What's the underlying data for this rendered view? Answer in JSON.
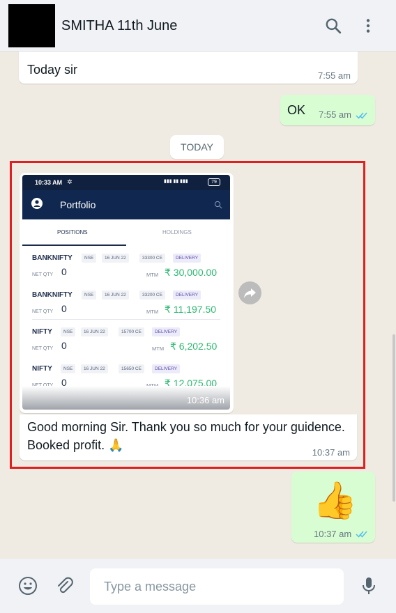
{
  "header": {
    "contact_name": "SMITHA 11th June",
    "icons": [
      "search-icon",
      "menu-icon"
    ]
  },
  "messages": {
    "m1": {
      "text": "Today sir",
      "time": "7:55 am",
      "direction": "incoming"
    },
    "m2": {
      "text": "OK",
      "time": "7:55 am",
      "direction": "outgoing",
      "status": "read"
    },
    "date_chip": "TODAY",
    "m3": {
      "image_time": "10:36 am",
      "caption_line1": "Good morning Sir. Thank you so much for your guidence.",
      "caption_line2": "Booked profit. 🙏",
      "time": "10:37 am",
      "direction": "incoming"
    },
    "m4": {
      "emoji": "👍",
      "time": "10:37 am",
      "direction": "outgoing",
      "status": "read"
    }
  },
  "screenshot": {
    "status_time": "10:33 AM",
    "status_right": "79",
    "app_title": "Portfolio",
    "tab_positions": "POSITIONS",
    "tab_holdings": "HOLDINGS",
    "net_qty_label": "NET QTY",
    "mtm_label": "MTM",
    "rows": [
      {
        "symbol": "BANKNIFTY",
        "exchange": "NSE",
        "expiry": "16 JUN 22",
        "strike": "33300 CE",
        "type": "DELIVERY",
        "net_qty": "0",
        "mtm": "₹ 30,000.00"
      },
      {
        "symbol": "BANKNIFTY",
        "exchange": "NSE",
        "expiry": "16 JUN 22",
        "strike": "33200 CE",
        "type": "DELIVERY",
        "net_qty": "0",
        "mtm": "₹ 11,197.50"
      },
      {
        "symbol": "NIFTY",
        "exchange": "NSE",
        "expiry": "16 JUN 22",
        "strike": "15700 CE",
        "type": "DELIVERY",
        "net_qty": "0",
        "mtm": "₹ 6,202.50"
      },
      {
        "symbol": "NIFTY",
        "exchange": "NSE",
        "expiry": "16 JUN 22",
        "strike": "15650 CE",
        "type": "DELIVERY",
        "net_qty": "0",
        "mtm": "₹ 12,075.00"
      }
    ]
  },
  "footer": {
    "placeholder": "Type a message",
    "icons": [
      "emoji-icon",
      "attach-icon",
      "mic-icon"
    ]
  },
  "colors": {
    "outgoing_bubble": "#d9fdd3",
    "incoming_bubble": "#ffffff",
    "highlight_border": "#e02020",
    "read_ticks": "#53bdeb",
    "mtm_green": "#2eb872"
  }
}
